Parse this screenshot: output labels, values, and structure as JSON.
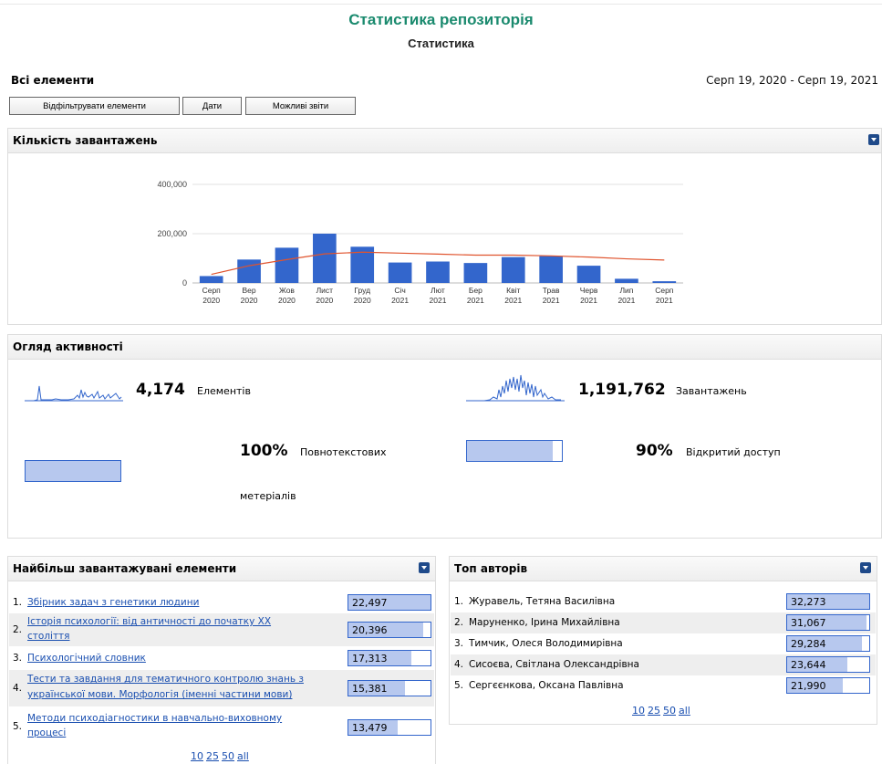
{
  "header": {
    "title": "Статистика репозиторія",
    "subtitle": "Статистика"
  },
  "all_items": {
    "title": "Всі елементи",
    "date_range": "Серп 19, 2020 - Серп 19, 2021"
  },
  "buttons": {
    "filter": "Відфільтрувати елементи",
    "dates": "Дати",
    "reports": "Можливі звіти"
  },
  "downloads_panel": {
    "title": "Кількість завантажень"
  },
  "chart_data": {
    "type": "bar",
    "categories": [
      [
        "Серп",
        "2020"
      ],
      [
        "Вер",
        "2020"
      ],
      [
        "Жов",
        "2020"
      ],
      [
        "Лист",
        "2020"
      ],
      [
        "Груд",
        "2020"
      ],
      [
        "Січ",
        "2021"
      ],
      [
        "Лют",
        "2021"
      ],
      [
        "Бер",
        "2021"
      ],
      [
        "Квіт",
        "2021"
      ],
      [
        "Трав",
        "2021"
      ],
      [
        "Черв",
        "2021"
      ],
      [
        "Лип",
        "2021"
      ],
      [
        "Серп",
        "2021"
      ]
    ],
    "values": [
      28000,
      95000,
      143000,
      200000,
      147000,
      83000,
      87000,
      81000,
      105000,
      109000,
      70000,
      17000,
      7000
    ],
    "trend": [
      35000,
      70000,
      95000,
      118000,
      125000,
      121000,
      117000,
      113000,
      113000,
      110000,
      105000,
      98000,
      93000
    ],
    "y_ticks": [
      "0",
      "200,000",
      "400,000"
    ],
    "ylim": [
      0,
      400000
    ],
    "bar_color": "#3366cc",
    "trend_color": "#e0542e",
    "grid": true
  },
  "activity_panel": {
    "title": "Огляд активності",
    "items_value": "4,174",
    "items_label": "Елементів",
    "downloads_value": "1,191,762",
    "downloads_label": "Завантажень",
    "fulltext_value": "100%",
    "fulltext_label_1": "Повнотекстових",
    "fulltext_label_2": "метеріалів",
    "fulltext_fraction": 1.0,
    "open_value": "90%",
    "open_label": "Відкритий доступ",
    "open_fraction": 0.9
  },
  "top_items": {
    "title": "Найбільш завантажувані елементи",
    "rows": [
      {
        "num": "1.",
        "title1": "Збірник задач з генетики людини",
        "title2": "",
        "value": "22,497",
        "fraction": 1.0
      },
      {
        "num": "2.",
        "title1": "Історія психології: від античності до початку ХХ",
        "title2": "століття",
        "value": "20,396",
        "fraction": 0.907
      },
      {
        "num": "3.",
        "title1": "Психологічний словник",
        "title2": "",
        "value": "17,313",
        "fraction": 0.77
      },
      {
        "num": "4.",
        "title1": "Тести та завдання для тематичного контролю знань з",
        "title2": "української мови. Морфологія (іменні частини мови)",
        "value": "15,381",
        "fraction": 0.684
      },
      {
        "num": "5.",
        "title1": "Методи психодіагностики в навчально-виховному",
        "title2": "процесі",
        "value": "13,479",
        "fraction": 0.6
      }
    ],
    "pager": [
      "10",
      "25",
      "50",
      "all"
    ]
  },
  "top_authors": {
    "title": "Топ авторів",
    "rows": [
      {
        "num": "1.",
        "name": "Журавель, Тетяна Василівна",
        "value": "32,273",
        "fraction": 1.0
      },
      {
        "num": "2.",
        "name": "Маруненко, Ірина Михайлівна",
        "value": "31,067",
        "fraction": 0.963
      },
      {
        "num": "3.",
        "name": "Тимчик, Олеся Володимирівна",
        "value": "29,284",
        "fraction": 0.907
      },
      {
        "num": "4.",
        "name": "Сисоєва, Світлана Олександрівна",
        "value": "23,644",
        "fraction": 0.733
      },
      {
        "num": "5.",
        "name": "Сергєєнкова, Оксана Павлівна",
        "value": "21,990",
        "fraction": 0.681
      }
    ],
    "pager": [
      "10",
      "25",
      "50",
      "all"
    ]
  }
}
